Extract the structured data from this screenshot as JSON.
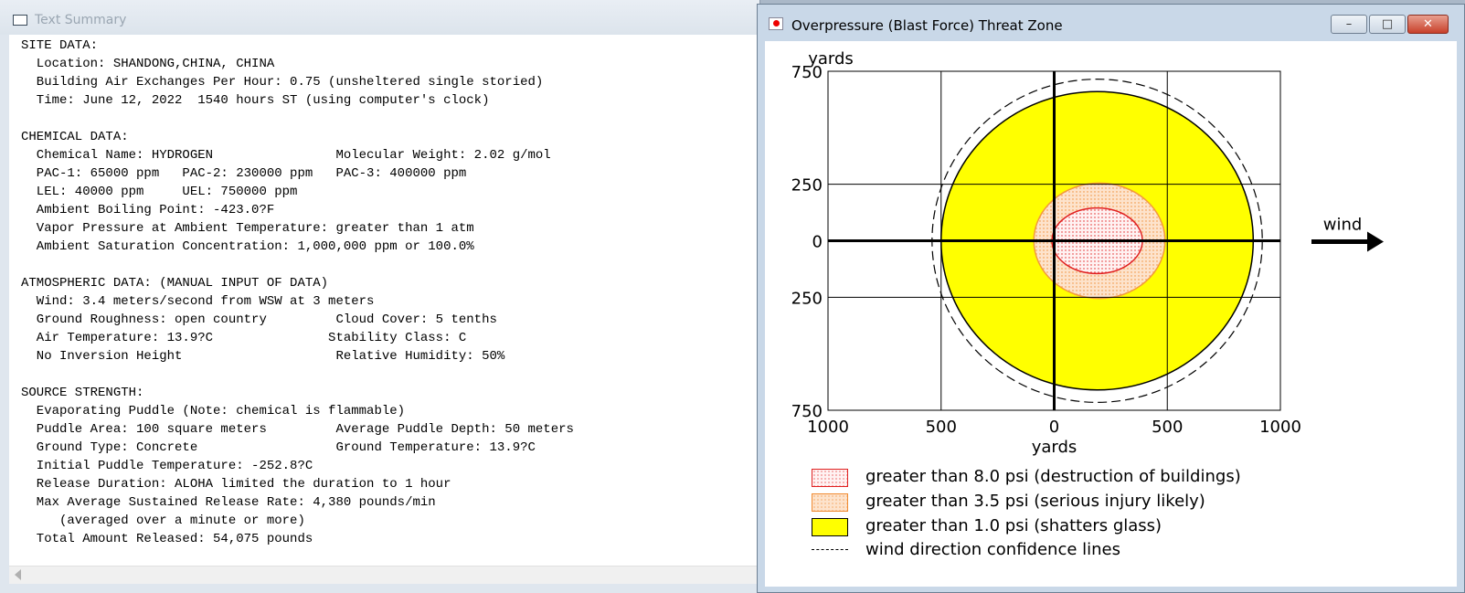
{
  "left_window": {
    "title": "Text Summary",
    "summary_lines": [
      "SITE DATA:",
      "  Location: SHANDONG,CHINA, CHINA",
      "  Building Air Exchanges Per Hour: 0.75 (unsheltered single storied)",
      "  Time: June 12, 2022  1540 hours ST (using computer's clock)",
      "",
      "CHEMICAL DATA:",
      "  Chemical Name: HYDROGEN                Molecular Weight: 2.02 g/mol",
      "  PAC-1: 65000 ppm   PAC-2: 230000 ppm   PAC-3: 400000 ppm",
      "  LEL: 40000 ppm     UEL: 750000 ppm",
      "  Ambient Boiling Point: -423.0?F",
      "  Vapor Pressure at Ambient Temperature: greater than 1 atm",
      "  Ambient Saturation Concentration: 1,000,000 ppm or 100.0%",
      "",
      "ATMOSPHERIC DATA: (MANUAL INPUT OF DATA)",
      "  Wind: 3.4 meters/second from WSW at 3 meters",
      "  Ground Roughness: open country         Cloud Cover: 5 tenths",
      "  Air Temperature: 13.9?C               Stability Class: C",
      "  No Inversion Height                    Relative Humidity: 50%",
      "",
      "SOURCE STRENGTH:",
      "  Evaporating Puddle (Note: chemical is flammable)",
      "  Puddle Area: 100 square meters         Average Puddle Depth: 50 meters",
      "  Ground Type: Concrete                  Ground Temperature: 13.9?C",
      "  Initial Puddle Temperature: -252.8?C",
      "  Release Duration: ALOHA limited the duration to 1 hour",
      "  Max Average Sustained Release Rate: 4,380 pounds/min",
      "     (averaged over a minute or more)",
      "  Total Amount Released: 54,075 pounds"
    ]
  },
  "right_window": {
    "title": "Overpressure (Blast Force) Threat Zone",
    "buttons": {
      "minimize": "–",
      "maximize": "□",
      "close": "✕"
    }
  },
  "chart_data": {
    "type": "threat-zone-map",
    "y_unit_label": "yards",
    "x_unit_label": "yards",
    "xlim": [
      -1000,
      1000
    ],
    "ylim": [
      -750,
      750
    ],
    "x_ticks": [
      -1000,
      -500,
      0,
      500,
      1000
    ],
    "x_tick_labels": [
      "1000",
      "500",
      "0",
      "500",
      "1000"
    ],
    "y_ticks": [
      750,
      250,
      0,
      -250,
      -750
    ],
    "y_tick_labels": [
      "750",
      "250",
      "0",
      "250",
      "750"
    ],
    "grid": true,
    "wind_label": "wind",
    "wind_direction": "right",
    "zones": [
      {
        "name": "yellow",
        "label": "greater than 1.0 psi (shatters glass)",
        "center_x": 190,
        "center_y": 0,
        "radius_x": 690,
        "radius_y": 660,
        "fill": "#ffff00",
        "stroke": "#000000",
        "pattern": "solid"
      },
      {
        "name": "orange",
        "label": "greater than 3.5 psi (serious injury likely)",
        "center_x": 200,
        "center_y": 0,
        "radius_x": 290,
        "radius_y": 255,
        "fill": "#fde0c8",
        "stroke": "#f39a3a",
        "pattern": "dots"
      },
      {
        "name": "red",
        "label": "greater than 8.0 psi (destruction of buildings)",
        "center_x": 190,
        "center_y": 0,
        "radius_x": 200,
        "radius_y": 145,
        "fill": "#ffe6e6",
        "stroke": "#e02020",
        "pattern": "dots"
      }
    ],
    "confidence_lines": {
      "label": "wind direction confidence lines",
      "radius_x": 730,
      "radius_y": 715,
      "center_x": 190,
      "center_y": 0
    },
    "legend_order": [
      "red",
      "orange",
      "yellow",
      "confidence"
    ]
  }
}
